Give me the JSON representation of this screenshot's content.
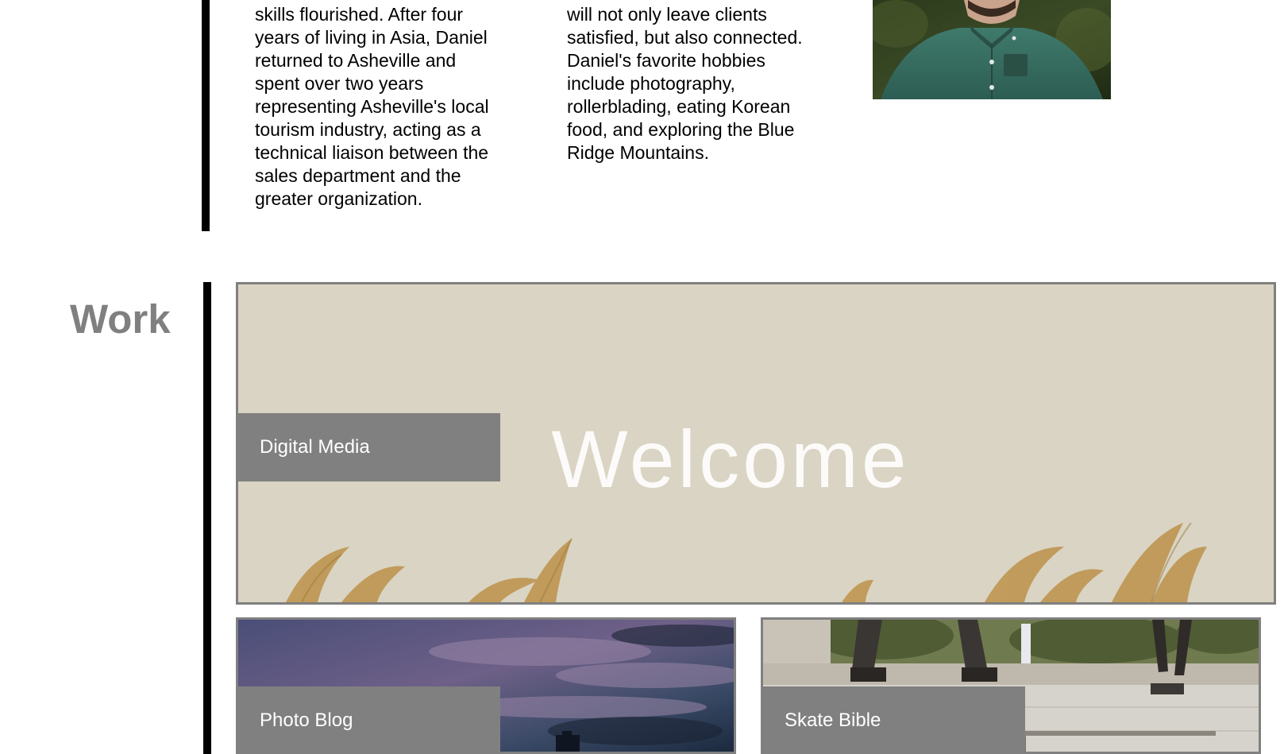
{
  "about": {
    "column1": [
      "skills flourished. After four",
      "years of living in Asia, Daniel",
      "returned to Asheville and",
      "spent over two years",
      "representing Asheville's local",
      "tourism industry, acting as a",
      "technical liaison between the",
      "sales department and the",
      "greater organization."
    ],
    "column2": [
      "will not only leave clients",
      "satisfied, but also connected.",
      "Daniel's favorite hobbies",
      "include photography,",
      "rollerblading, eating Korean",
      "food, and exploring the Blue",
      "Ridge Mountains."
    ]
  },
  "work": {
    "heading": "Work",
    "tiles": [
      {
        "label": "Digital Media",
        "image_text": "Welcome"
      },
      {
        "label": "Photo Blog"
      },
      {
        "label": "Skate Bible"
      }
    ]
  },
  "colors": {
    "accent_gray": "#808080",
    "digital_bg": "#dad4c4",
    "bar": "#000000"
  }
}
